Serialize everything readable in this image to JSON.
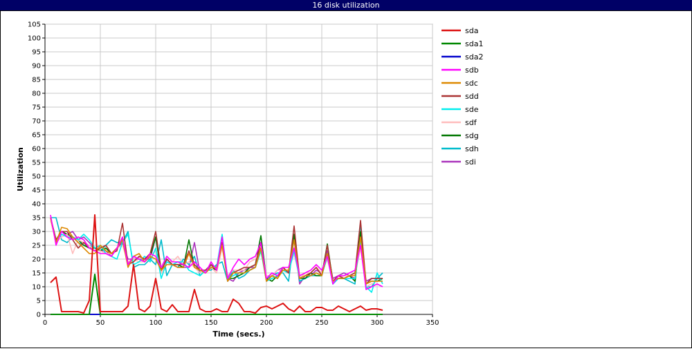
{
  "window": {
    "title": "16 disk utilization"
  },
  "chart_data": {
    "type": "line",
    "xlabel": "Time (secs.)",
    "ylabel": "Utilization",
    "xlim": [
      0,
      350
    ],
    "ylim": [
      0,
      105
    ],
    "xticks": [
      0,
      50,
      100,
      150,
      200,
      250,
      300,
      350
    ],
    "yticks": [
      0,
      5,
      10,
      15,
      20,
      25,
      30,
      35,
      40,
      45,
      50,
      55,
      60,
      65,
      70,
      75,
      80,
      85,
      90,
      95,
      100,
      105
    ],
    "grid": true,
    "legend_position": "right",
    "series": [
      {
        "name": "sda",
        "color": "#dd1111",
        "x": [
          5,
          10,
          15,
          20,
          25,
          30,
          35,
          40,
          45,
          50,
          55,
          60,
          65,
          70,
          75,
          80,
          85,
          90,
          95,
          100,
          105,
          110,
          115,
          120,
          125,
          130,
          135,
          140,
          145,
          150,
          155,
          160,
          165,
          170,
          175,
          180,
          185,
          190,
          195,
          200,
          205,
          210,
          215,
          220,
          225,
          230,
          235,
          240,
          245,
          250,
          255,
          260,
          265,
          270,
          275,
          280,
          285,
          290,
          295,
          300,
          305
        ],
        "y": [
          11.5,
          13.5,
          1,
          1,
          1,
          1,
          0.5,
          5,
          36,
          1,
          1,
          1,
          1,
          1,
          3,
          18,
          2,
          1,
          3,
          13,
          2,
          1,
          3.5,
          1,
          1,
          1,
          9,
          2,
          1,
          1,
          2,
          1,
          1,
          5.5,
          4,
          1,
          1,
          0.5,
          2.5,
          3,
          2,
          3,
          4,
          2,
          1,
          3,
          1,
          1,
          2.5,
          2.5,
          1.5,
          1.5,
          3,
          2,
          1,
          2,
          3,
          1.5,
          2,
          2,
          1.5
        ]
      },
      {
        "name": "sda1",
        "color": "#008800",
        "x": [
          5,
          40,
          45,
          50,
          305
        ],
        "y": [
          0,
          0,
          14.5,
          0,
          0
        ]
      },
      {
        "name": "sda2",
        "color": "#0000cc",
        "x": [
          5,
          305
        ],
        "y": [
          0,
          0
        ]
      },
      {
        "name": "sdb",
        "color": "#ff00ff",
        "x": [
          5,
          10,
          15,
          20,
          25,
          30,
          35,
          40,
          45,
          50,
          55,
          60,
          65,
          70,
          75,
          80,
          85,
          90,
          95,
          100,
          105,
          110,
          115,
          120,
          125,
          130,
          135,
          140,
          145,
          150,
          155,
          160,
          165,
          170,
          175,
          180,
          185,
          190,
          195,
          200,
          205,
          210,
          215,
          220,
          225,
          230,
          235,
          240,
          245,
          250,
          255,
          260,
          265,
          270,
          275,
          280,
          285,
          290,
          295,
          300,
          305
        ],
        "y": [
          36,
          25,
          30,
          28,
          27,
          28,
          27,
          24,
          23,
          22,
          22,
          21,
          24,
          28,
          18,
          21,
          20,
          19,
          22,
          21,
          17,
          21,
          19,
          19,
          18,
          17,
          19,
          17,
          15,
          19,
          16,
          28,
          13,
          17,
          20,
          18,
          20,
          21,
          26,
          13,
          15,
          14,
          17,
          17,
          24,
          14,
          15,
          16,
          18,
          16,
          21,
          11,
          14,
          14,
          15,
          16,
          25,
          9,
          10,
          11,
          10
        ]
      },
      {
        "name": "sdc",
        "color": "#dd8800",
        "x": [
          5,
          10,
          15,
          20,
          25,
          30,
          35,
          40,
          45,
          50,
          55,
          60,
          65,
          70,
          75,
          80,
          85,
          90,
          95,
          100,
          105,
          110,
          115,
          120,
          125,
          130,
          135,
          140,
          145,
          150,
          155,
          160,
          165,
          170,
          175,
          180,
          185,
          190,
          195,
          200,
          205,
          210,
          215,
          220,
          225,
          230,
          235,
          240,
          245,
          250,
          255,
          260,
          265,
          270,
          275,
          280,
          285,
          290,
          295,
          300,
          305
        ],
        "y": [
          35,
          26,
          31.5,
          31,
          28,
          26,
          24,
          22,
          22,
          25,
          23,
          22,
          24,
          27,
          17,
          21,
          22,
          19,
          21,
          20,
          16,
          18,
          18,
          17,
          17,
          22,
          17,
          16,
          15,
          17,
          17,
          25,
          12,
          15,
          15,
          15,
          16,
          17,
          24,
          12,
          14,
          13,
          16,
          16,
          27,
          13,
          14,
          14,
          15,
          14,
          22,
          12,
          13,
          13,
          14,
          14,
          28,
          11,
          12,
          12,
          12
        ]
      },
      {
        "name": "sdd",
        "color": "#aa3333",
        "x": [
          5,
          10,
          15,
          20,
          25,
          30,
          35,
          40,
          45,
          50,
          55,
          60,
          65,
          70,
          75,
          80,
          85,
          90,
          95,
          100,
          105,
          110,
          115,
          120,
          125,
          130,
          135,
          140,
          145,
          150,
          155,
          160,
          165,
          170,
          175,
          180,
          185,
          190,
          195,
          200,
          205,
          210,
          215,
          220,
          225,
          230,
          235,
          240,
          245,
          250,
          255,
          260,
          265,
          270,
          275,
          280,
          285,
          290,
          295,
          300,
          305
        ],
        "y": [
          35,
          27,
          30,
          30,
          27,
          24,
          26,
          24,
          23,
          24,
          25,
          22,
          23,
          33,
          18,
          19,
          21,
          20,
          22,
          30,
          16,
          20,
          18,
          18,
          18,
          23,
          18,
          16,
          16,
          18,
          16,
          26,
          12,
          15,
          16,
          17,
          17,
          18,
          26,
          12,
          14,
          13,
          17,
          15,
          32,
          13,
          14,
          15,
          17,
          14,
          25,
          12,
          14,
          13,
          14,
          15,
          34,
          11,
          13,
          13,
          13
        ]
      },
      {
        "name": "sde",
        "color": "#00eeee",
        "x": [
          5,
          10,
          15,
          20,
          25,
          30,
          35,
          40,
          45,
          50,
          55,
          60,
          65,
          70,
          75,
          80,
          85,
          90,
          95,
          100,
          105,
          110,
          115,
          120,
          125,
          130,
          135,
          140,
          145,
          150,
          155,
          160,
          165,
          170,
          175,
          180,
          185,
          190,
          195,
          200,
          205,
          210,
          215,
          220,
          225,
          230,
          235,
          240,
          245,
          250,
          255,
          260,
          265,
          270,
          275,
          280,
          285,
          290,
          295,
          300,
          305
        ],
        "y": [
          35,
          27,
          29,
          28,
          28,
          27,
          29,
          27,
          24,
          25,
          22,
          21,
          20,
          26,
          29,
          18,
          19,
          21,
          19,
          24,
          13,
          19,
          18,
          19,
          19,
          16,
          15,
          14,
          16,
          18,
          17,
          29,
          13,
          14,
          15,
          15,
          16,
          17,
          23,
          12,
          13,
          14,
          16,
          15,
          23,
          13,
          14,
          14,
          15,
          14,
          21,
          11,
          13,
          13,
          13,
          13,
          27,
          10,
          8,
          15,
          11
        ]
      },
      {
        "name": "sdf",
        "color": "#ffbbbb",
        "x": [
          5,
          10,
          15,
          20,
          25,
          30,
          35,
          40,
          45,
          50,
          55,
          60,
          65,
          70,
          75,
          80,
          85,
          90,
          95,
          100,
          105,
          110,
          115,
          120,
          125,
          130,
          135,
          140,
          145,
          150,
          155,
          160,
          165,
          170,
          175,
          180,
          185,
          190,
          195,
          200,
          205,
          210,
          215,
          220,
          225,
          230,
          235,
          240,
          245,
          250,
          255,
          260,
          265,
          270,
          275,
          280,
          285,
          290,
          295,
          300,
          305
        ],
        "y": [
          34,
          26,
          28,
          29,
          22,
          27,
          26,
          25,
          23,
          23,
          22,
          22,
          24,
          25,
          19,
          20,
          19,
          19,
          21,
          23,
          15,
          19,
          19,
          21,
          18,
          19,
          17,
          15,
          15,
          17,
          15,
          24,
          14,
          16,
          16,
          16,
          19,
          20,
          24,
          14,
          14,
          16,
          16,
          16,
          22,
          13,
          15,
          15,
          17,
          15,
          20,
          12,
          13,
          14,
          14,
          14,
          24,
          10,
          11,
          12,
          12
        ]
      },
      {
        "name": "sdg",
        "color": "#007700",
        "x": [
          5,
          10,
          15,
          20,
          25,
          30,
          35,
          40,
          45,
          50,
          55,
          60,
          65,
          70,
          75,
          80,
          85,
          90,
          95,
          100,
          105,
          110,
          115,
          120,
          125,
          130,
          135,
          140,
          145,
          150,
          155,
          160,
          165,
          170,
          175,
          180,
          185,
          190,
          195,
          200,
          205,
          210,
          215,
          220,
          225,
          230,
          235,
          240,
          245,
          250,
          255,
          260,
          265,
          270,
          275,
          280,
          285,
          290,
          295,
          300,
          305
        ],
        "y": [
          35,
          27,
          30,
          29,
          28,
          27,
          25,
          24,
          24,
          23,
          24,
          22,
          24,
          27,
          18,
          21,
          20,
          19,
          21,
          28,
          15,
          20,
          18,
          18,
          17,
          27,
          17,
          16,
          15,
          17,
          16,
          26,
          13,
          13,
          14,
          15,
          17,
          18,
          28.5,
          13,
          12,
          14,
          16,
          15,
          29,
          13,
          13,
          15,
          14,
          14,
          25.5,
          12,
          13,
          13,
          14,
          12,
          30,
          11,
          12,
          12,
          13
        ]
      },
      {
        "name": "sdh",
        "color": "#00bbcc",
        "x": [
          5,
          10,
          15,
          20,
          25,
          30,
          35,
          40,
          45,
          50,
          55,
          60,
          65,
          70,
          75,
          80,
          85,
          90,
          95,
          100,
          105,
          110,
          115,
          120,
          125,
          130,
          135,
          140,
          145,
          150,
          155,
          160,
          165,
          170,
          175,
          180,
          185,
          190,
          195,
          200,
          205,
          210,
          215,
          220,
          225,
          230,
          235,
          240,
          245,
          250,
          255,
          260,
          265,
          270,
          275,
          280,
          285,
          290,
          295,
          300,
          305
        ],
        "y": [
          35,
          35,
          27,
          26,
          28,
          26,
          25,
          25,
          24,
          23,
          25,
          27,
          26,
          26,
          30,
          17,
          18,
          18,
          20,
          18,
          27,
          14,
          18,
          17,
          20,
          18,
          21,
          14,
          16,
          16,
          18,
          19,
          12,
          16,
          13,
          14,
          16,
          17,
          23,
          13,
          14,
          15,
          15,
          12,
          28,
          12,
          13,
          14,
          14,
          14,
          22,
          11,
          13,
          13,
          12,
          11,
          33,
          10,
          10,
          13,
          15
        ]
      },
      {
        "name": "sdi",
        "color": "#aa33bb",
        "x": [
          5,
          10,
          15,
          20,
          25,
          30,
          35,
          40,
          45,
          50,
          55,
          60,
          65,
          70,
          75,
          80,
          85,
          90,
          95,
          100,
          105,
          110,
          115,
          120,
          125,
          130,
          135,
          140,
          145,
          150,
          155,
          160,
          165,
          170,
          175,
          180,
          185,
          190,
          195,
          200,
          205,
          210,
          215,
          220,
          225,
          230,
          235,
          240,
          245,
          250,
          255,
          260,
          265,
          270,
          275,
          280,
          285,
          290,
          295,
          300,
          305
        ],
        "y": [
          35,
          27,
          30,
          29,
          30,
          27,
          28,
          26,
          24,
          23,
          23,
          21,
          24,
          26,
          20,
          20,
          20,
          20,
          20,
          28,
          15,
          20,
          18,
          17,
          17,
          17,
          26,
          15,
          15,
          18,
          16,
          26,
          13,
          12,
          15,
          16,
          17,
          17,
          24,
          13,
          14,
          16,
          17,
          15,
          27,
          11,
          14,
          14,
          16,
          15,
          23,
          13,
          14,
          15,
          14,
          13,
          29,
          12,
          13,
          13,
          13
        ]
      }
    ]
  }
}
